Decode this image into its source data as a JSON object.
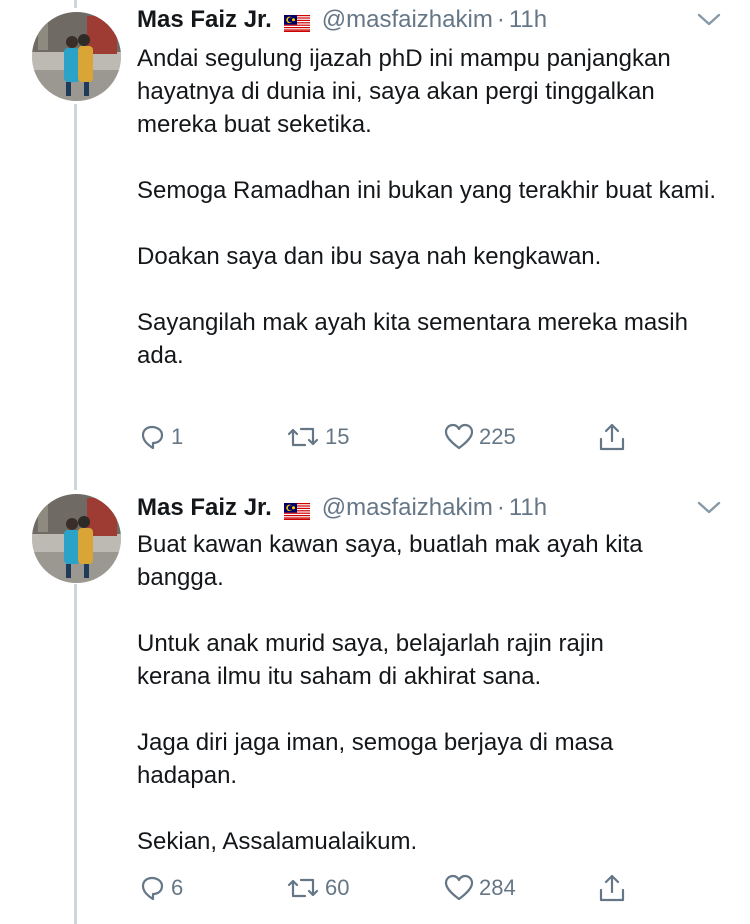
{
  "colors": {
    "text": "#14171a",
    "muted": "#657786",
    "thread_line": "#ccd6dd"
  },
  "tweets": [
    {
      "author_name": "Mas Faiz Jr.",
      "flag": "malaysia-flag",
      "handle": "@masfaizhakim",
      "separator": "·",
      "time": "11h",
      "paragraphs": [
        "Andai segulung ijazah phD ini mampu panjangkan hayatnya di dunia ini, saya akan pergi tinggalkan mereka buat seketika.",
        "Semoga Ramadhan ini bukan yang terakhir buat kami.",
        "Doakan saya dan ibu saya nah kengkawan.",
        "Sayangilah mak ayah kita sementara mereka masih ada."
      ],
      "replies": "1",
      "retweets": "15",
      "likes": "225"
    },
    {
      "author_name": "Mas Faiz Jr.",
      "flag": "malaysia-flag",
      "handle": "@masfaizhakim",
      "separator": "·",
      "time": "11h",
      "paragraphs": [
        "Buat kawan kawan saya, buatlah mak ayah kita bangga.",
        "Untuk anak murid saya, belajarlah rajin rajin kerana ilmu itu saham di akhirat sana.",
        "Jaga diri jaga iman, semoga berjaya di masa hadapan.",
        "Sekian, Assalamualaikum."
      ],
      "replies": "6",
      "retweets": "60",
      "likes": "284"
    }
  ]
}
